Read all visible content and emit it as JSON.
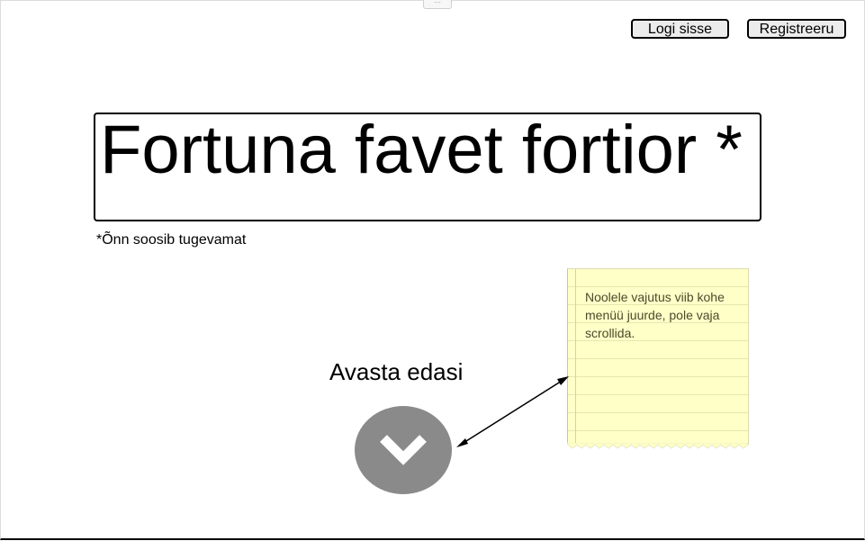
{
  "header": {
    "login_label": "Logi sisse",
    "register_label": "Registreeru",
    "handle_label": "···"
  },
  "hero": {
    "title": "Fortuna favet fortior *",
    "footnote": "*Õnn soosib tugevamat"
  },
  "cta": {
    "text": "Avasta edasi",
    "icon": "chevron-down-icon",
    "button_color": "#8a8a8a"
  },
  "sticky_note": {
    "text": "Noolele vajutus viib kohe menüü juurde, pole vaja scrollida.",
    "background_color": "#ffffc8"
  }
}
